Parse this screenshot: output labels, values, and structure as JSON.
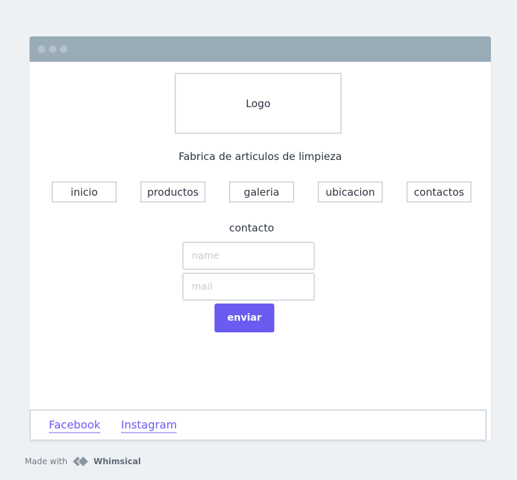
{
  "window": {
    "logo_label": "Logo",
    "tagline": "Fabrica de articulos de limpieza"
  },
  "nav": {
    "items": [
      "inicio",
      "productos",
      "galeria",
      "ubicacion",
      "contactos"
    ]
  },
  "contact": {
    "title": "contacto",
    "name_placeholder": "name",
    "mail_placeholder": "mail",
    "submit_label": "enviar"
  },
  "footer": {
    "links": [
      "Facebook",
      "Instagram"
    ]
  },
  "watermark": {
    "prefix": "Made with",
    "brand": "Whimsical"
  },
  "colors": {
    "accent": "#6a5cf0",
    "titlebar": "#9aabb8",
    "border": "#d4dce2",
    "background": "#eef1f4"
  }
}
